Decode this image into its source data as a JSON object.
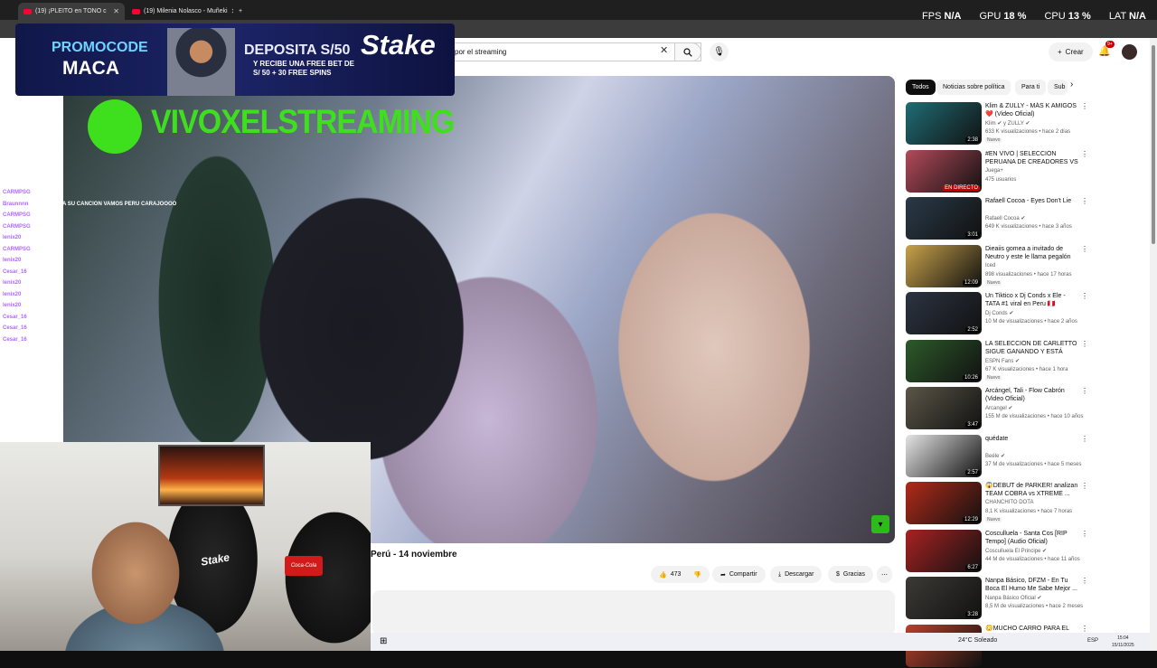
{
  "tabs": [
    {
      "label": "(19) ¡PLEITO en TONO c",
      "active": true
    },
    {
      "label": "(19) Milenia Nolasco - Muñeki",
      "active": false
    }
  ],
  "stats": [
    {
      "label": "FPS",
      "value": "N/A"
    },
    {
      "label": "GPU",
      "value": "18 %"
    },
    {
      "label": "CPU",
      "value": "13 %"
    },
    {
      "label": "LAT",
      "value": "N/A"
    }
  ],
  "search": {
    "value": "por el streaming"
  },
  "header": {
    "create_label": "Crear",
    "notif_count": "9+"
  },
  "ad": {
    "promo_l1": "PROMOCODE",
    "promo_l2": "MACA",
    "deposit": "DEPOSITA S/50",
    "receive_l1": "Y RECIBE UNA FREE BET DE",
    "receive_l2": "S/ 50 + 30 FREE SPINS",
    "brand": "Stake"
  },
  "video": {
    "watermark": "VIVOXELSTREAMING",
    "title": "Perú - 14 noviembre",
    "likes": "473",
    "share_label": "Compartir",
    "download_label": "Descargar",
    "thanks_label": "Gracias"
  },
  "chat": [
    {
      "user": "CARMPSG",
      "msg": ""
    },
    {
      "user": "Braunnnn",
      "msg": ": ESTA BUENA SU CANCION VAMOS PERU CARAJOOOO"
    },
    {
      "user": "CARMPSG",
      "msg": ""
    },
    {
      "user": "CARMPSG",
      "msg": ""
    },
    {
      "user": "lenix20",
      "msg": ""
    },
    {
      "user": "CARMPSG",
      "msg": ""
    },
    {
      "user": "lenix20",
      "msg": ""
    },
    {
      "user": "Cesar_16",
      "msg": ""
    },
    {
      "user": "lenix20",
      "msg": ""
    },
    {
      "user": "lenix20",
      "msg": ""
    },
    {
      "user": "lenix20",
      "msg": ""
    },
    {
      "user": "Cesar_16",
      "msg": ""
    },
    {
      "user": "Cesar_16",
      "msg": ""
    },
    {
      "user": "Cesar_16",
      "msg": ""
    }
  ],
  "webcam": {
    "chair_brand": "Stake",
    "cup": "Coca-Cola"
  },
  "chips": [
    {
      "label": "Todos",
      "active": true
    },
    {
      "label": "Noticias sobre política",
      "active": false
    },
    {
      "label": "Para ti",
      "active": false
    },
    {
      "label": "Sub",
      "active": false
    }
  ],
  "recommendations": [
    {
      "title": "Klim & ZULLY - MÁS K AMIGOS ❤️ (Video Oficial)",
      "channel": "Klim ✔ y ZULLY ✔",
      "meta": "633 K visualizaciones • hace 2 días",
      "duration": "2:38",
      "badge": "Nuevo",
      "color": "#1f6d75"
    },
    {
      "title": "#EN VIVO | SELECCIÓN PERUANA DE CREADORES VS ...",
      "channel": "Juega+",
      "meta": "475 usuarios",
      "duration": "EN DIRECTO",
      "badge": "",
      "color": "#b34a5a"
    },
    {
      "title": "Rafaell Cocoa - Eyes Don't Lie",
      "channel": "Rafaell Cocoa ✔",
      "meta": "649 K visualizaciones • hace 3 años",
      "duration": "3:01",
      "badge": "",
      "color": "#2a3a48"
    },
    {
      "title": "Dieaiis gomea a invitado de Neutro y este le llama pegalón",
      "channel": "Iced",
      "meta": "898 visualizaciones • hace 17 horas",
      "duration": "12:09",
      "badge": "Nuevo",
      "color": "#c8a24a"
    },
    {
      "title": "Un Tiktico x Dj Conds x Ele - TATA #1 viral en Peru 🇵🇪",
      "channel": "Dj Conds ✔",
      "meta": "10 M de visualizaciones • hace 2 años",
      "duration": "2:52",
      "badge": "",
      "color": "#2c3442"
    },
    {
      "title": "LA SELECCIÓN DE CARLETTO SIGUE GANANDO Y ESTÁ CAD...",
      "channel": "ESPN Fans ✔",
      "meta": "67 K visualizaciones • hace 1 hora",
      "duration": "10:26",
      "badge": "Nuevo",
      "color": "#2d5a2a"
    },
    {
      "title": "Arcángel, Tali - Flow Cabrón (Video Oficial)",
      "channel": "Arcangel ✔",
      "meta": "155 M de visualizaciones • hace 10 años",
      "duration": "3:47",
      "badge": "",
      "color": "#5b5648"
    },
    {
      "title": "quédate",
      "channel": "Beéle ✔",
      "meta": "37 M de visualizaciones • hace 5 meses",
      "duration": "2:57",
      "badge": "",
      "color": "#e5e5e5"
    },
    {
      "title": "😱DEBUT de PARKER! analizan TEAM COBRA vs XTREME ...",
      "channel": "CHANCHITO DOTA",
      "meta": "8,1 K visualizaciones • hace 7 horas",
      "duration": "12:29",
      "badge": "Nuevo",
      "color": "#b22a1a"
    },
    {
      "title": "Cosculluela - Santa Cos [RIP Tempo] (Audio Oficial)",
      "channel": "Cosculluela El Principe ✔",
      "meta": "44 M de visualizaciones • hace 11 años",
      "duration": "6:27",
      "badge": "",
      "color": "#a82222"
    },
    {
      "title": "Nanpa Básico, DFZM - En Tu Boca El Humo Me Sabe Mejor ...",
      "channel": "Nanpa Básico Oficial ✔",
      "meta": "8,5 M de visualizaciones • hace 2 meses",
      "duration": "3:28",
      "badge": "",
      "color": "#3c3a36"
    },
    {
      "title": "😳MUCHO CARRO PARA EL",
      "channel": "",
      "meta": "",
      "duration": "",
      "badge": "",
      "color": "#b8412a"
    }
  ],
  "taskbar": {
    "weather": "24°C  Soleado",
    "lang": "ESP",
    "time": "15:04",
    "date": "15/11/2025"
  }
}
